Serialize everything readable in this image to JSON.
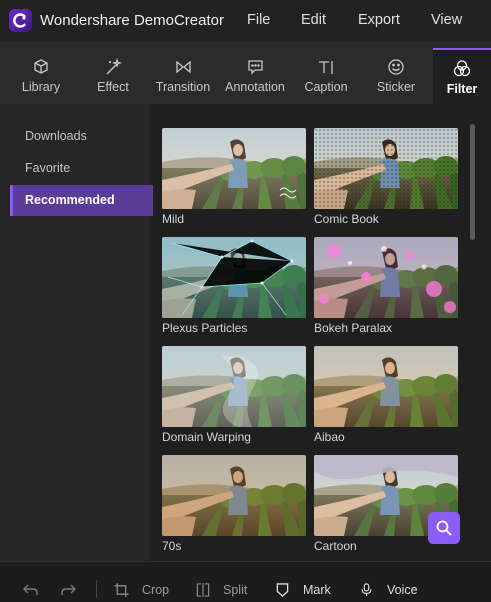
{
  "app": {
    "title": "Wondershare DemoCreator"
  },
  "menu": {
    "file": "File",
    "edit": "Edit",
    "export": "Export",
    "view": "View"
  },
  "tabs": [
    {
      "label": "Library",
      "icon": "cube-icon"
    },
    {
      "label": "Effect",
      "icon": "magic-wand-icon"
    },
    {
      "label": "Transition",
      "icon": "bowtie-icon"
    },
    {
      "label": "Annotation",
      "icon": "speech-bubble-icon"
    },
    {
      "label": "Caption",
      "icon": "text-cursor-icon"
    },
    {
      "label": "Sticker",
      "icon": "smiley-icon"
    },
    {
      "label": "Filter",
      "icon": "overlapping-circles-icon",
      "active": true
    }
  ],
  "sidebar": {
    "items": [
      {
        "label": "Downloads"
      },
      {
        "label": "Favorite"
      },
      {
        "label": "Recommended",
        "active": true
      }
    ]
  },
  "filters": [
    {
      "name": "Mild"
    },
    {
      "name": "Comic Book"
    },
    {
      "name": "Plexus Particles"
    },
    {
      "name": "Bokeh Paralax"
    },
    {
      "name": "Domain Warping"
    },
    {
      "name": "Aibao"
    },
    {
      "name": "70s"
    },
    {
      "name": "Cartoon"
    }
  ],
  "bottom_bar": {
    "undo_icon": "undo-icon",
    "redo_icon": "redo-icon",
    "crop": "Crop",
    "split": "Split",
    "mark": "Mark",
    "voice": "Voice"
  },
  "colors": {
    "accent": "#8b5cf6",
    "active_bg": "#5b3d99",
    "background": "#1f1f1f"
  }
}
